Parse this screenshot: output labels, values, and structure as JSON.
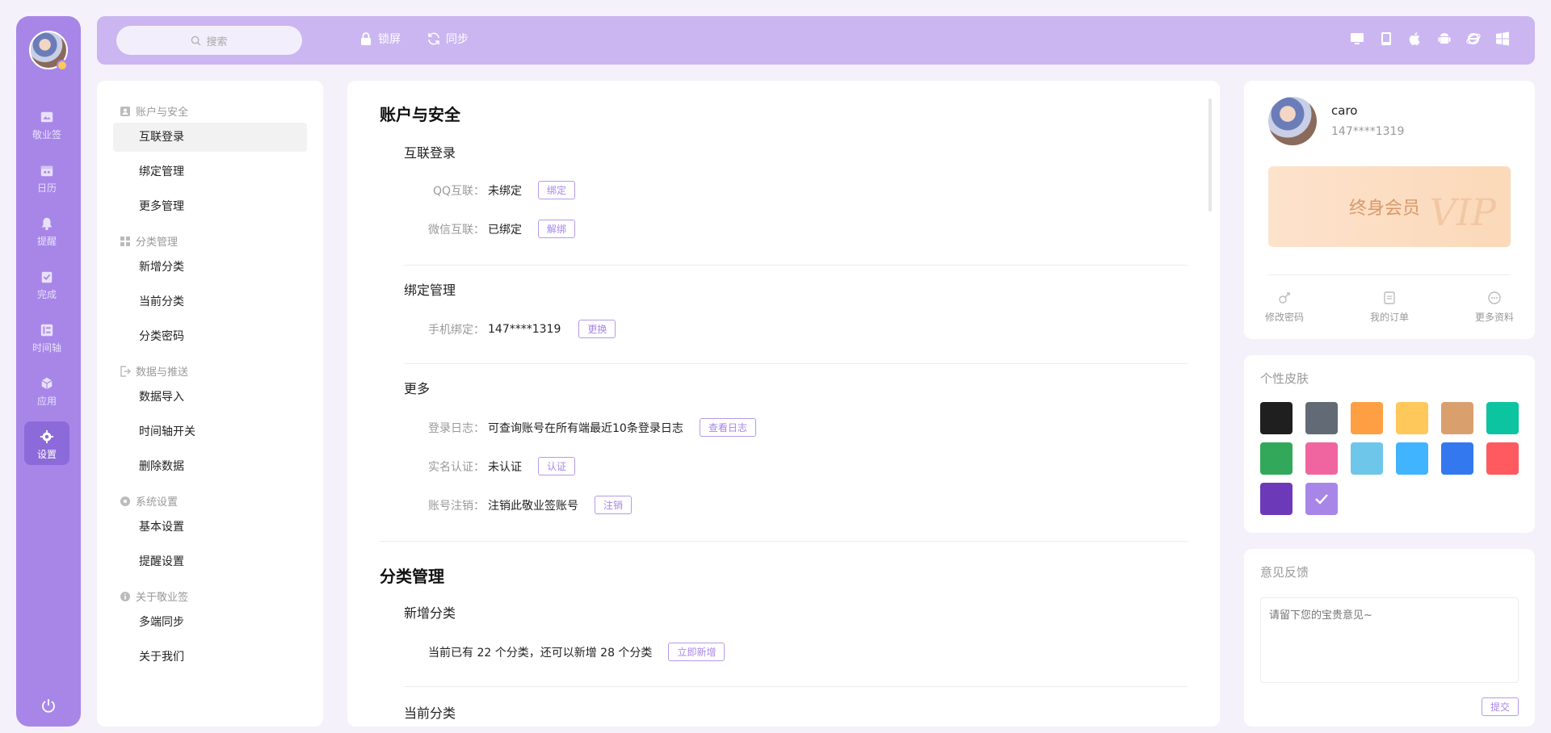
{
  "topbar": {
    "search_placeholder": "搜索",
    "lock_label": "锁屏",
    "sync_label": "同步",
    "platform_icons": [
      "desktop-icon",
      "tablet-icon",
      "apple-icon",
      "android-icon",
      "ie-icon",
      "windows-icon"
    ]
  },
  "rail": {
    "items": [
      {
        "label": "敬业签",
        "icon": "note-icon"
      },
      {
        "label": "日历",
        "icon": "calendar-icon"
      },
      {
        "label": "提醒",
        "icon": "bell-icon"
      },
      {
        "label": "完成",
        "icon": "check-icon"
      },
      {
        "label": "时间轴",
        "icon": "timeline-icon"
      },
      {
        "label": "应用",
        "icon": "cube-icon"
      },
      {
        "label": "设置",
        "icon": "gear-icon",
        "active": true
      }
    ]
  },
  "menu": {
    "groups": [
      {
        "label": "账户与安全",
        "icon": "account-icon",
        "items": [
          "互联登录",
          "绑定管理",
          "更多管理"
        ]
      },
      {
        "label": "分类管理",
        "icon": "grid-icon",
        "items": [
          "新增分类",
          "当前分类",
          "分类密码"
        ]
      },
      {
        "label": "数据与推送",
        "icon": "export-icon",
        "items": [
          "数据导入",
          "时间轴开关",
          "删除数据"
        ]
      },
      {
        "label": "系统设置",
        "icon": "system-gear-icon",
        "items": [
          "基本设置",
          "提醒设置"
        ]
      },
      {
        "label": "关于敬业签",
        "icon": "info-icon",
        "items": [
          "多端同步",
          "关于我们"
        ]
      }
    ],
    "active_item": "互联登录"
  },
  "content": {
    "account_title": "账户与安全",
    "interconnect": {
      "title": "互联登录",
      "qq": {
        "key": "QQ互联：",
        "value": "未绑定",
        "button": "绑定"
      },
      "wechat": {
        "key": "微信互联：",
        "value": "已绑定",
        "button": "解绑"
      }
    },
    "binding": {
      "title": "绑定管理",
      "phone": {
        "key": "手机绑定：",
        "value": "147****1319",
        "button": "更换"
      }
    },
    "more": {
      "title": "更多",
      "log": {
        "key": "登录日志：",
        "value": "可查询账号在所有端最近10条登录日志",
        "button": "查看日志"
      },
      "realname": {
        "key": "实名认证：",
        "value": "未认证",
        "button": "认证"
      },
      "cancel": {
        "key": "账号注销：",
        "value": "注销此敬业签账号",
        "button": "注销"
      }
    },
    "category_title": "分类管理",
    "new_category": {
      "title": "新增分类",
      "text": "当前已有 22 个分类，还可以新增 28 个分类",
      "button": "立即新增"
    },
    "current_category_title": "当前分类"
  },
  "profile": {
    "name": "caro",
    "phone": "147****1319",
    "vip_label": "终身会员",
    "vip_watermark": "VIP",
    "actions": [
      {
        "label": "修改密码",
        "icon": "key-icon"
      },
      {
        "label": "我的订单",
        "icon": "order-icon"
      },
      {
        "label": "更多资料",
        "icon": "more-icon"
      }
    ]
  },
  "skin": {
    "title": "个性皮肤",
    "colors": [
      "#1f1f1f",
      "#626b75",
      "#ff9f43",
      "#ffc85a",
      "#d9a06e",
      "#0cc4a0",
      "#32a85a",
      "#f0659f",
      "#6ec6ea",
      "#40b4ff",
      "#3478f0",
      "#ff5a5f",
      "#6c3ab8",
      "#a786e8"
    ],
    "selected_index": 13
  },
  "feedback": {
    "title": "意见反馈",
    "placeholder": "请留下您的宝贵意见~",
    "submit": "提交"
  }
}
